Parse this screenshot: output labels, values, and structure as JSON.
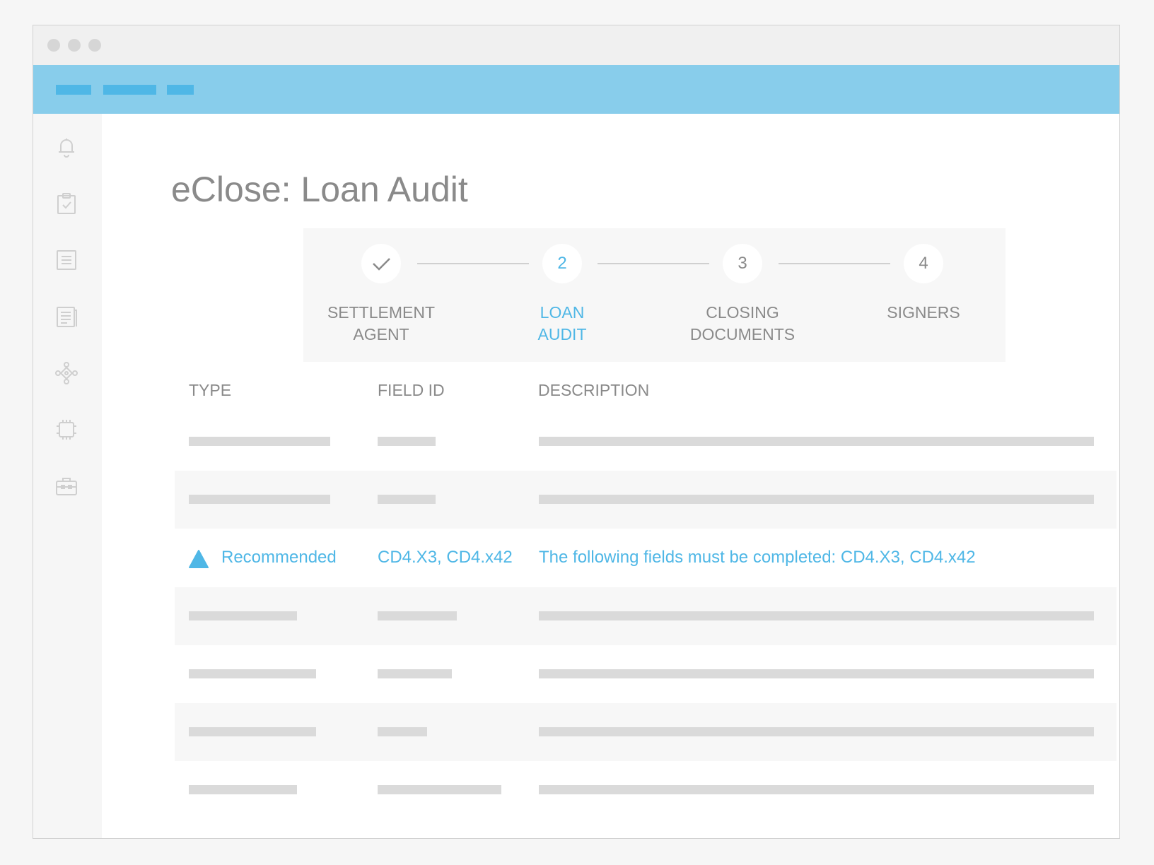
{
  "page": {
    "title": "eClose: Loan Audit"
  },
  "colors": {
    "accent": "#4fb7e6",
    "appbar": "#88cdeb",
    "muted_text": "#8a8a8a",
    "placeholder": "#dadada"
  },
  "sidebar": {
    "icons": [
      "bell-icon",
      "clipboard-check-icon",
      "list-icon",
      "document-icon",
      "network-icon",
      "chip-icon",
      "briefcase-icon"
    ]
  },
  "stepper": {
    "steps": [
      {
        "number": "",
        "icon": "check-icon",
        "label_line1": "SETTLEMENT",
        "label_line2": "AGENT",
        "state": "complete"
      },
      {
        "number": "2",
        "label_line1": "LOAN",
        "label_line2": "AUDIT",
        "state": "active"
      },
      {
        "number": "3",
        "label_line1": "CLOSING",
        "label_line2": "DOCUMENTS",
        "state": "pending"
      },
      {
        "number": "4",
        "label_line1": "SIGNERS",
        "label_line2": "",
        "state": "pending"
      }
    ]
  },
  "table": {
    "headers": {
      "type": "TYPE",
      "field_id": "FIELD ID",
      "description": "DESCRIPTION"
    },
    "highlight_row": {
      "icon": "warning-triangle-icon",
      "type": "Recommended",
      "field_id": "CD4.X3, CD4.x42",
      "description": "The following fields must be completed: CD4.X3, CD4.x42"
    }
  }
}
